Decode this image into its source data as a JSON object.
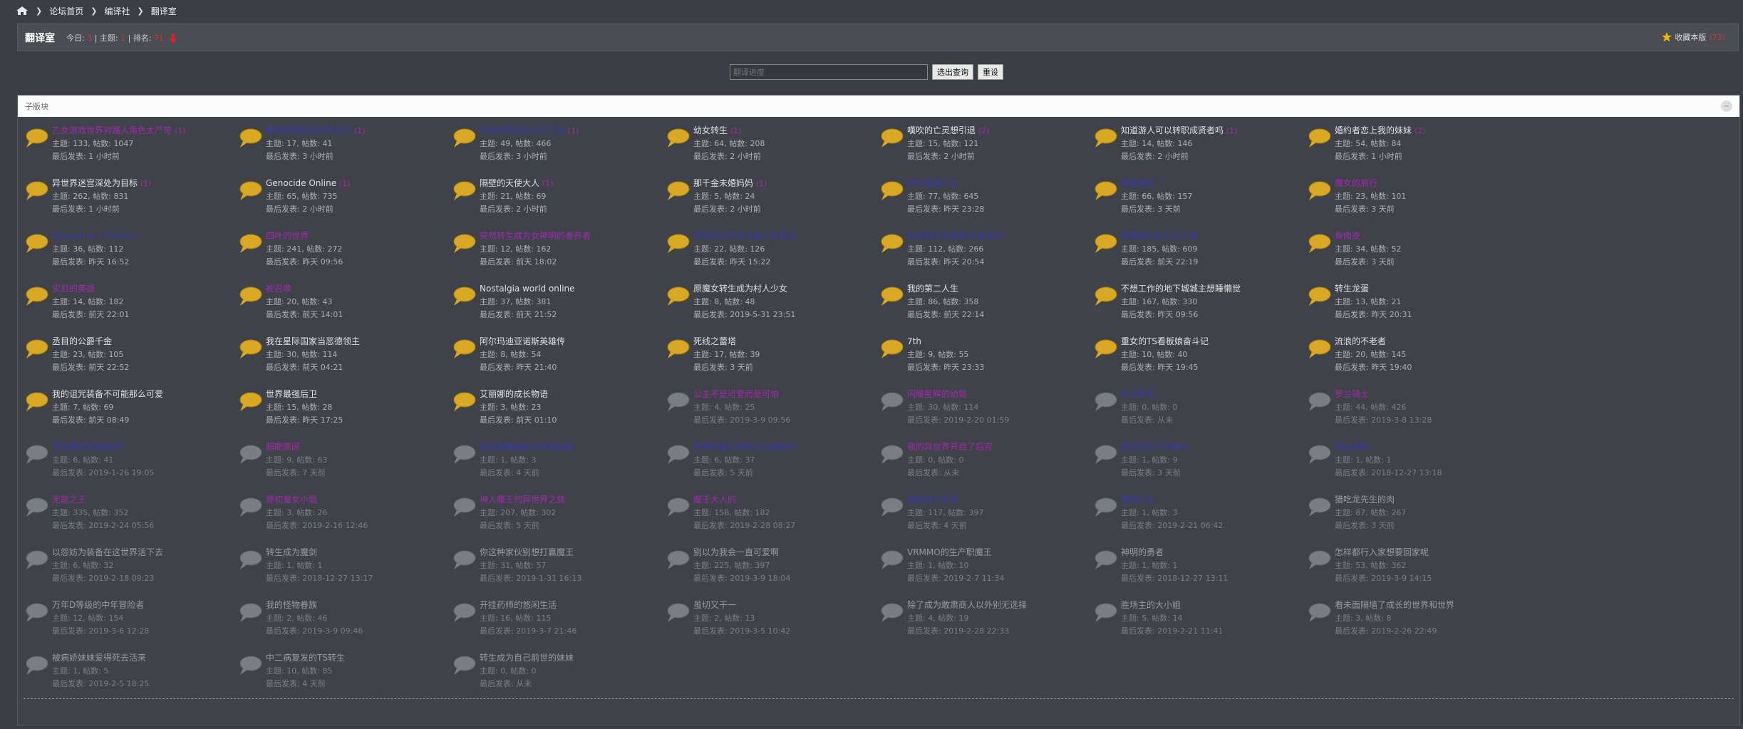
{
  "breadcrumb": {
    "home_icon": "home-icon",
    "items": [
      "论坛首页",
      "编译社",
      "翻译室"
    ]
  },
  "forum": {
    "title": "翻译室",
    "today_label": "今日:",
    "today_value": "3",
    "topics_label": "主题:",
    "topics_value": "1",
    "rank_label": "排名:",
    "rank_value": "71",
    "rank_icon": "down-arrow-icon",
    "fav_label": "收藏本版",
    "fav_count": "(73)",
    "fav_icon": "star-icon"
  },
  "search": {
    "value": "",
    "placeholder": "翻译进度",
    "submit": "选出查询",
    "reset": "重设"
  },
  "panel": {
    "title": "子版块",
    "collapse_icon": "collapse-icon"
  },
  "labels": {
    "topics": "主题:",
    "posts": "帖数:",
    "last": "最后发表:"
  },
  "subforums": [
    {
      "name": "乙女游戏世界对路人角色太严苛",
      "cls": "purple",
      "count": "(1)",
      "t": "133",
      "p": "1047",
      "last": "1 小时前",
      "dim": false
    },
    {
      "name": "魔弹罗莉的异世界战记",
      "cls": "blue",
      "count": "(1)",
      "t": "17",
      "p": "41",
      "last": "3 小时前",
      "dim": false
    },
    {
      "name": "外挂药师的异世界之旅",
      "cls": "blue",
      "count": "(1)",
      "t": "49",
      "p": "466",
      "last": "3 小时前",
      "dim": false
    },
    {
      "name": "幼女转生",
      "cls": "",
      "count": "(1)",
      "t": "64",
      "p": "208",
      "last": "2 小时前",
      "dim": false
    },
    {
      "name": "嘆吹的亡灵想引退",
      "cls": "",
      "count": "(2)",
      "t": "15",
      "p": "121",
      "last": "2 小时前",
      "dim": false
    },
    {
      "name": "知道游人可以转职成贤者吗",
      "cls": "",
      "count": "(1)",
      "t": "14",
      "p": "146",
      "last": "2 小时前",
      "dim": false
    },
    {
      "name": "婚约者恋上我的妹妹",
      "cls": "",
      "count": "(2)",
      "t": "54",
      "p": "84",
      "last": "1 小时前",
      "dim": false
    },
    {
      "name": "异世界迷宫深处为目标",
      "cls": "",
      "count": "(1)",
      "t": "262",
      "p": "831",
      "last": "1 小时前",
      "dim": false
    },
    {
      "name": "Genocide Online",
      "cls": "",
      "count": "(1)",
      "t": "65",
      "p": "735",
      "last": "2 小时前",
      "dim": false
    },
    {
      "name": "隔壁的天使大人",
      "cls": "",
      "count": "(1)",
      "t": "21",
      "p": "69",
      "last": "2 小时前",
      "dim": false
    },
    {
      "name": "那千金未婚妈妈",
      "cls": "",
      "count": "(1)",
      "t": "5",
      "p": "24",
      "last": "2 小时前",
      "dim": false
    },
    {
      "name": "转生英雄之女",
      "cls": "blue",
      "count": "",
      "t": "77",
      "p": "645",
      "last": "昨天 23:28",
      "dim": false
    },
    {
      "name": "神童神技",
      "cls": "blue",
      "count": "",
      "t": "66",
      "p": "157",
      "last": "3 天前",
      "dim": false
    },
    {
      "name": "魔女的旅行",
      "cls": "purple",
      "count": "",
      "t": "23",
      "p": "101",
      "last": "3 天前",
      "dim": false
    },
    {
      "name": "Shangri-la・Frontier",
      "cls": "blue",
      "count": "",
      "t": "36",
      "p": "112",
      "last": "昨天 16:52",
      "dim": false
    },
    {
      "name": "四叶的世界",
      "cls": "purple",
      "count": "",
      "t": "241",
      "p": "272",
      "last": "昨天 09:56",
      "dim": false
    },
    {
      "name": "突然转生成为女神明的眷养者",
      "cls": "purple",
      "count": "",
      "t": "12",
      "p": "162",
      "last": "前天 18:02",
      "dim": false
    },
    {
      "name": "转生异世界成为美少女城主",
      "cls": "blue",
      "count": "",
      "t": "22",
      "p": "126",
      "last": "昨天 15:22",
      "dim": false
    },
    {
      "name": "你这种女主角我说没法忍！",
      "cls": "blue",
      "count": "",
      "t": "112",
      "p": "266",
      "last": "昨天 20:54",
      "dim": false
    },
    {
      "name": "想要成为影之实力者",
      "cls": "blue",
      "count": "",
      "t": "185",
      "p": "609",
      "last": "前天 22:19",
      "dim": false
    },
    {
      "name": "骨肉皮",
      "cls": "purple",
      "count": "",
      "t": "34",
      "p": "52",
      "last": "3 天前",
      "dim": false
    },
    {
      "name": "灾厄的英雄",
      "cls": "purple",
      "count": "",
      "t": "14",
      "p": "182",
      "last": "前天 22:01",
      "dim": false
    },
    {
      "name": "被召唤",
      "cls": "purple",
      "count": "",
      "t": "20",
      "p": "43",
      "last": "前天 14:01",
      "dim": false
    },
    {
      "name": "Nostalgia world online",
      "cls": "",
      "count": "",
      "t": "37",
      "p": "381",
      "last": "前天 21:52",
      "dim": false
    },
    {
      "name": "原魔女转生成为村人少女",
      "cls": "",
      "count": "",
      "t": "8",
      "p": "48",
      "last": "2019-5-31 23:51",
      "dim": false
    },
    {
      "name": "我的第二人生",
      "cls": "",
      "count": "",
      "t": "86",
      "p": "358",
      "last": "前天 22:14",
      "dim": false
    },
    {
      "name": "不想工作的地下城城主想睡懒觉",
      "cls": "",
      "count": "",
      "t": "167",
      "p": "330",
      "last": "昨天 09:56",
      "dim": false
    },
    {
      "name": "转生龙蛋",
      "cls": "",
      "count": "",
      "t": "13",
      "p": "21",
      "last": "昨天 20:31",
      "dim": false
    },
    {
      "name": "丞目的公爵千金",
      "cls": "",
      "count": "",
      "t": "23",
      "p": "105",
      "last": "前天 22:52",
      "dim": false
    },
    {
      "name": "我在星际国家当恶德领主",
      "cls": "",
      "count": "",
      "t": "30",
      "p": "114",
      "last": "前天 04:21",
      "dim": false
    },
    {
      "name": "阿尔玛迪亚诺斯英雄传",
      "cls": "",
      "count": "",
      "t": "8",
      "p": "54",
      "last": "昨天 21:40",
      "dim": false
    },
    {
      "name": "死线之蕾塔",
      "cls": "",
      "count": "",
      "t": "17",
      "p": "39",
      "last": "3 天前",
      "dim": false
    },
    {
      "name": "7th",
      "cls": "",
      "count": "",
      "t": "9",
      "p": "55",
      "last": "昨天 23:33",
      "dim": false
    },
    {
      "name": "重女的TS看板娘奋斗记",
      "cls": "",
      "count": "",
      "t": "10",
      "p": "40",
      "last": "昨天 19:45",
      "dim": false
    },
    {
      "name": "流浪的不老者",
      "cls": "",
      "count": "",
      "t": "20",
      "p": "145",
      "last": "昨天 19:40",
      "dim": false
    },
    {
      "name": "我的诅咒装备不可能那么可爱",
      "cls": "",
      "count": "",
      "t": "7",
      "p": "69",
      "last": "前天 08:49",
      "dim": false
    },
    {
      "name": "世界最强后卫",
      "cls": "",
      "count": "",
      "t": "15",
      "p": "28",
      "last": "昨天 17:25",
      "dim": false
    },
    {
      "name": "艾丽娜的成长物语",
      "cls": "",
      "count": "",
      "t": "3",
      "p": "23",
      "last": "前天 01:10",
      "dim": false
    },
    {
      "name": "公主不是可爱而是可怕",
      "cls": "purple",
      "count": "",
      "t": "4",
      "p": "25",
      "last": "2019-3-9 09:56",
      "dim": true
    },
    {
      "name": "闪耀星辉的幼姬",
      "cls": "purple",
      "count": "",
      "t": "30",
      "p": "114",
      "last": "2019-2-20 01:59",
      "dim": true
    },
    {
      "name": "毛玉转生",
      "cls": "blue",
      "count": "",
      "t": "0",
      "p": "0",
      "last": "从未",
      "dim": true
    },
    {
      "name": "罗兰骑士",
      "cls": "purple",
      "count": "",
      "t": "44",
      "p": "426",
      "last": "2019-3-8 13:28",
      "dim": true
    },
    {
      "name": "请问要欢爱旭留吗？",
      "cls": "blue",
      "count": "",
      "t": "6",
      "p": "41",
      "last": "2019-1-26 19:05",
      "dim": true
    },
    {
      "name": "超能原因",
      "cls": "purple",
      "count": "",
      "t": "9",
      "p": "63",
      "last": "7 天前",
      "dim": true
    },
    {
      "name": "屁股被蝙蝠异世界里赖着",
      "cls": "blue",
      "count": "",
      "t": "1",
      "p": "3",
      "last": "4 天前",
      "dim": true
    },
    {
      "name": "勇者和魔王同时出生被抛弃",
      "cls": "blue",
      "count": "",
      "t": "6",
      "p": "37",
      "last": "5 天前",
      "dim": true
    },
    {
      "name": "我的异世界开启了后宫",
      "cls": "purple",
      "count": "",
      "t": "0",
      "p": "0",
      "last": "从未",
      "dim": true
    },
    {
      "name": "原初军的不死魔王",
      "cls": "blue",
      "count": "",
      "t": "1",
      "p": "9",
      "last": "3 天前",
      "dim": true
    },
    {
      "name": "吸血鬼族",
      "cls": "blue",
      "count": "",
      "t": "1",
      "p": "1",
      "last": "2018-12-27 13:18",
      "dim": true
    },
    {
      "name": "无能之王",
      "cls": "purple",
      "count": "",
      "t": "335",
      "p": "352",
      "last": "2019-2-24 05:56",
      "dim": true
    },
    {
      "name": "原初魔女小姐",
      "cls": "purple",
      "count": "",
      "t": "3",
      "p": "26",
      "last": "2019-2-16 12:46",
      "dim": true
    },
    {
      "name": "神人魔王的异世界之旅",
      "cls": "purple",
      "count": "",
      "t": "207",
      "p": "302",
      "last": "5 天前",
      "dim": true
    },
    {
      "name": "魔王大人的",
      "cls": "purple",
      "count": "",
      "t": "158",
      "p": "182",
      "last": "2019-2-28 08:27",
      "dim": true
    },
    {
      "name": "魔装骑士物语",
      "cls": "blue",
      "count": "",
      "t": "117",
      "p": "397",
      "last": "4 天前",
      "dim": true
    },
    {
      "name": "偶然少女",
      "cls": "blue",
      "count": "",
      "t": "1",
      "p": "3",
      "last": "2019-2-21 06:42",
      "dim": true
    },
    {
      "name": "猎吃龙先生的肉",
      "cls": "",
      "count": "",
      "t": "87",
      "p": "267",
      "last": "3 天前",
      "dim": true
    },
    {
      "name": "以怨妨为装备在这世界活下去",
      "cls": "",
      "count": "",
      "t": "6",
      "p": "32",
      "last": "2019-2-18 09:23",
      "dim": true
    },
    {
      "name": "转生成为魔剑",
      "cls": "",
      "count": "",
      "t": "1",
      "p": "1",
      "last": "2018-12-27 13:17",
      "dim": true
    },
    {
      "name": "你这种家伙别想打赢魔王",
      "cls": "",
      "count": "",
      "t": "31",
      "p": "57",
      "last": "2019-1-31 16:13",
      "dim": true
    },
    {
      "name": "别以为我会一直可爱啊",
      "cls": "",
      "count": "",
      "t": "225",
      "p": "397",
      "last": "2019-3-9 18:04",
      "dim": true
    },
    {
      "name": "VRMMO的生产职魔王",
      "cls": "",
      "count": "",
      "t": "1",
      "p": "10",
      "last": "2019-2-7 11:34",
      "dim": true
    },
    {
      "name": "神明的勇者",
      "cls": "",
      "count": "",
      "t": "1",
      "p": "1",
      "last": "2018-12-27 13:11",
      "dim": true
    },
    {
      "name": "怎样都行入家想要回家呢",
      "cls": "",
      "count": "",
      "t": "53",
      "p": "362",
      "last": "2019-3-9 14:15",
      "dim": true
    },
    {
      "name": "万年D等级的中年冒险者",
      "cls": "",
      "count": "",
      "t": "12",
      "p": "154",
      "last": "2019-3-6 12:28",
      "dim": true
    },
    {
      "name": "我的怪物眷族",
      "cls": "",
      "count": "",
      "t": "2",
      "p": "46",
      "last": "2019-3-9 09:46",
      "dim": true
    },
    {
      "name": "开挂药师的悠闲生活",
      "cls": "",
      "count": "",
      "t": "16",
      "p": "115",
      "last": "2019-3-7 21:46",
      "dim": true
    },
    {
      "name": "虽切又干一",
      "cls": "",
      "count": "",
      "t": "2",
      "p": "13",
      "last": "2019-3-5 10:42",
      "dim": true
    },
    {
      "name": "除了成为敢肃商人以外别无选择",
      "cls": "",
      "count": "",
      "t": "4",
      "p": "19",
      "last": "2019-2-28 22:33",
      "dim": true
    },
    {
      "name": "胜场主的大小姐",
      "cls": "",
      "count": "",
      "t": "5",
      "p": "14",
      "last": "2019-2-21 11:41",
      "dim": true
    },
    {
      "name": "看未面隔墙了成长的世界和世界",
      "cls": "",
      "count": "",
      "t": "3",
      "p": "8",
      "last": "2019-2-26 22:49",
      "dim": true
    },
    {
      "name": "被病娇妹妹爱得死去活来",
      "cls": "",
      "count": "",
      "t": "1",
      "p": "5",
      "last": "2019-2-5 18:25",
      "dim": true
    },
    {
      "name": "中二病复发的TS转生",
      "cls": "",
      "count": "",
      "t": "10",
      "p": "85",
      "last": "4 天前",
      "dim": true
    },
    {
      "name": "转生成为自己前世的妹妹",
      "cls": "",
      "count": "",
      "t": "0",
      "p": "0",
      "last": "从未",
      "dim": true
    }
  ]
}
